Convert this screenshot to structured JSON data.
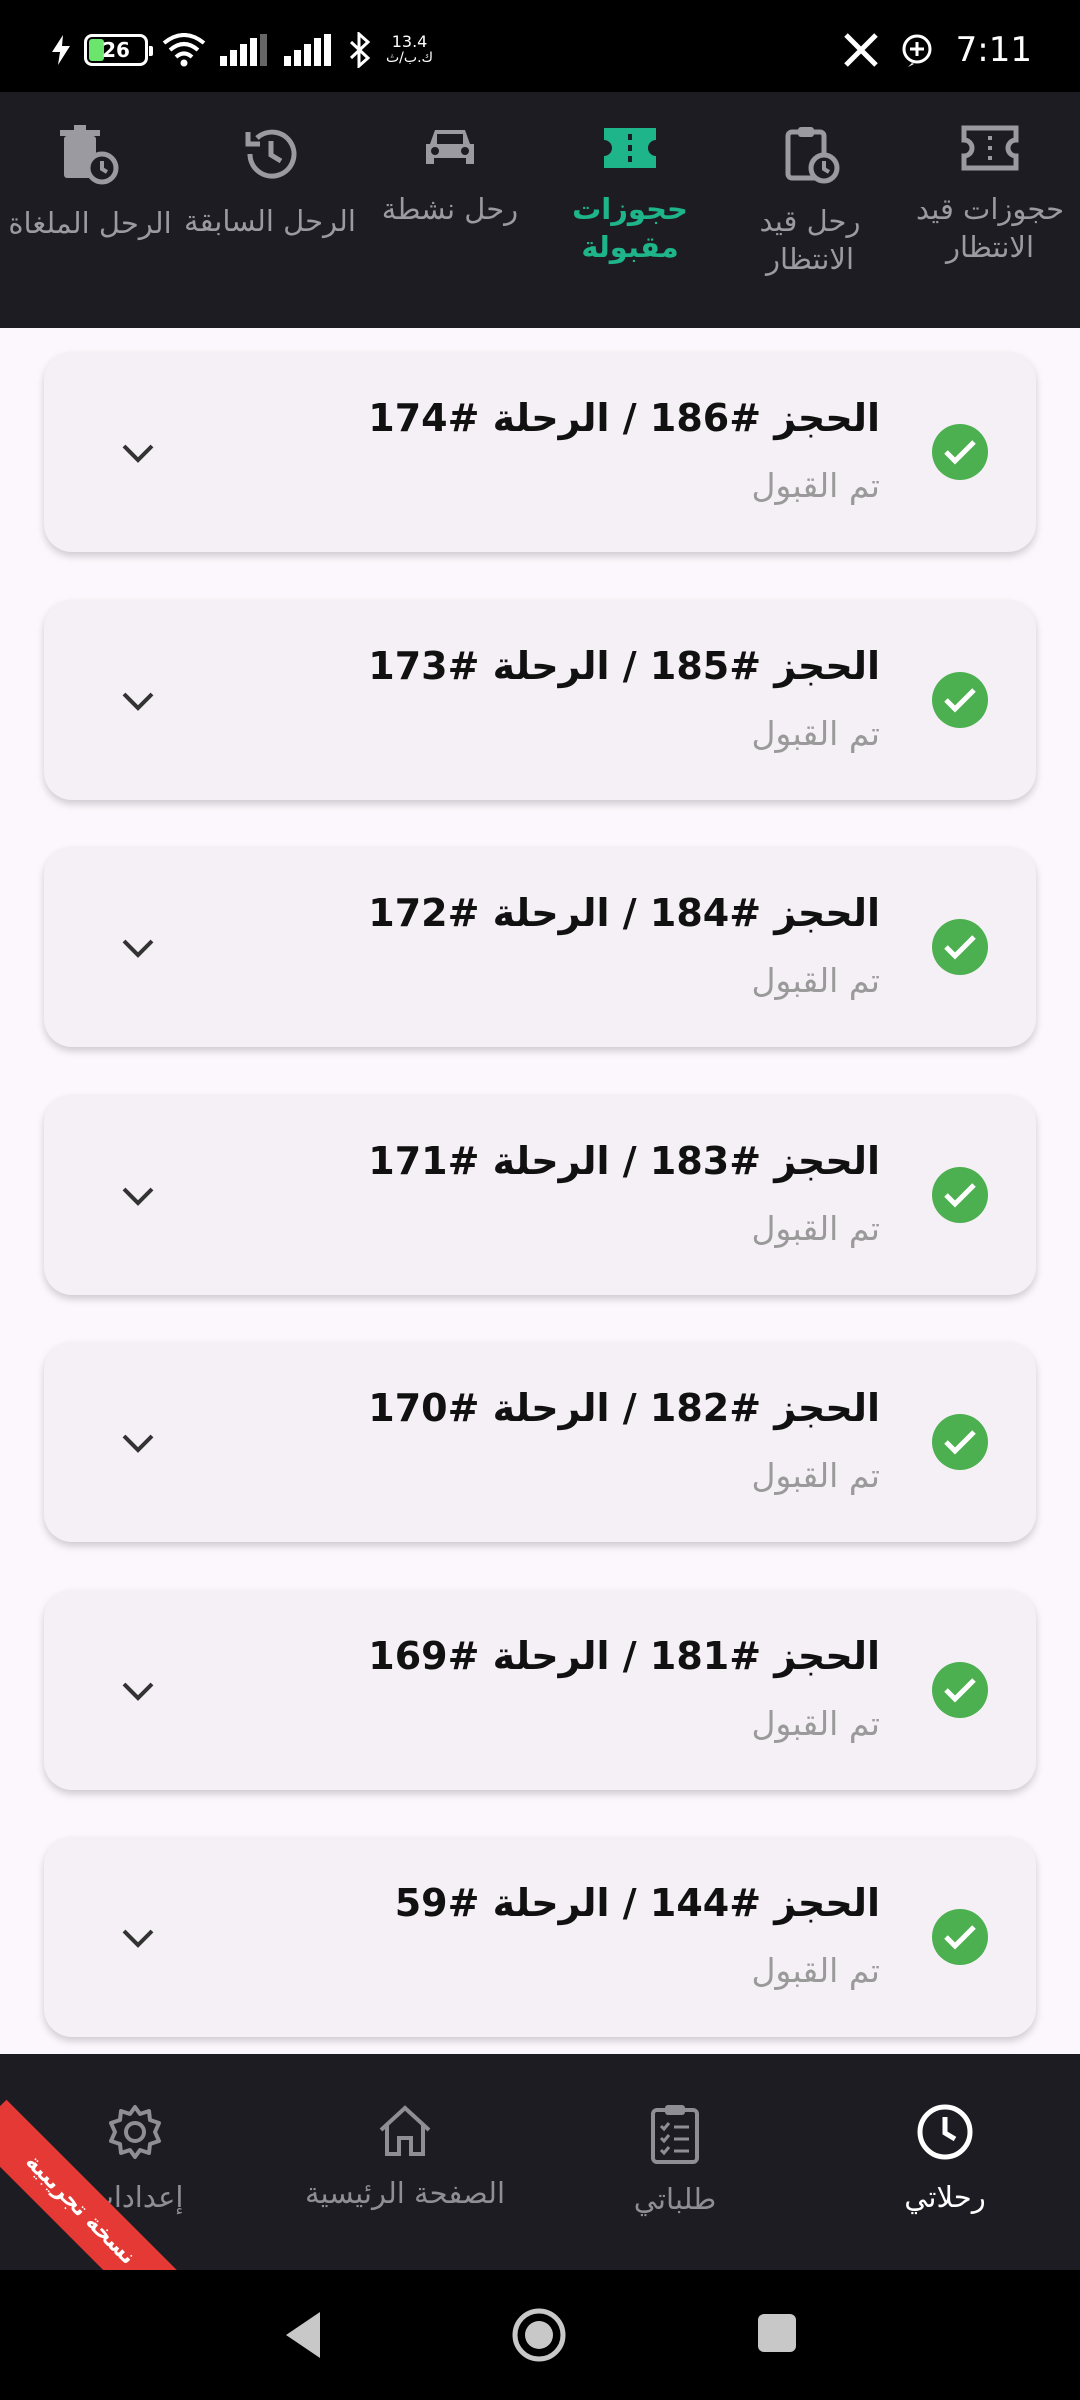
{
  "status_bar": {
    "battery": "26",
    "network_speed_value": "13.4",
    "network_speed_unit": "ك.ب/ث",
    "time": "7:11"
  },
  "top_tabs": [
    {
      "label": "حجوزات قيد الانتظار",
      "icon": "ticket-icon",
      "active": false
    },
    {
      "label": "رحل قيد الانتظار",
      "icon": "clipboard-clock-icon",
      "active": false
    },
    {
      "label": "حجوزات مقبولة",
      "icon": "ticket-filled-icon",
      "active": true
    },
    {
      "label": "رحل نشطة",
      "icon": "car-icon",
      "active": false
    },
    {
      "label": "الرحل السابقة",
      "icon": "history-icon",
      "active": false
    },
    {
      "label": "الرحل الملغاة",
      "icon": "trash-clock-icon",
      "active": false
    }
  ],
  "bookings": [
    {
      "title": "الحجز #186 / الرحلة #174",
      "status": "تم القبول"
    },
    {
      "title": "الحجز #185 / الرحلة #173",
      "status": "تم القبول"
    },
    {
      "title": "الحجز #184 / الرحلة #172",
      "status": "تم القبول"
    },
    {
      "title": "الحجز #183 / الرحلة #171",
      "status": "تم القبول"
    },
    {
      "title": "الحجز #182 / الرحلة #170",
      "status": "تم القبول"
    },
    {
      "title": "الحجز #181 / الرحلة #169",
      "status": "تم القبول"
    },
    {
      "title": "الحجز #144 / الرحلة #59",
      "status": "تم القبول"
    }
  ],
  "bottom_nav": [
    {
      "label": "رحلاتي",
      "icon": "clock-icon",
      "active": true
    },
    {
      "label": "طلباتي",
      "icon": "clipboard-list-icon",
      "active": false
    },
    {
      "label": "الصفحة الرئيسية",
      "icon": "home-icon",
      "active": false
    },
    {
      "label": "إعدادات",
      "icon": "gear-icon",
      "active": false
    }
  ],
  "ribbon_text": "نسخة تجريبية",
  "colors": {
    "accent": "#1fb58a",
    "success": "#4caf50",
    "dark_bar": "#1c1c22",
    "ribbon": "#e53935"
  }
}
